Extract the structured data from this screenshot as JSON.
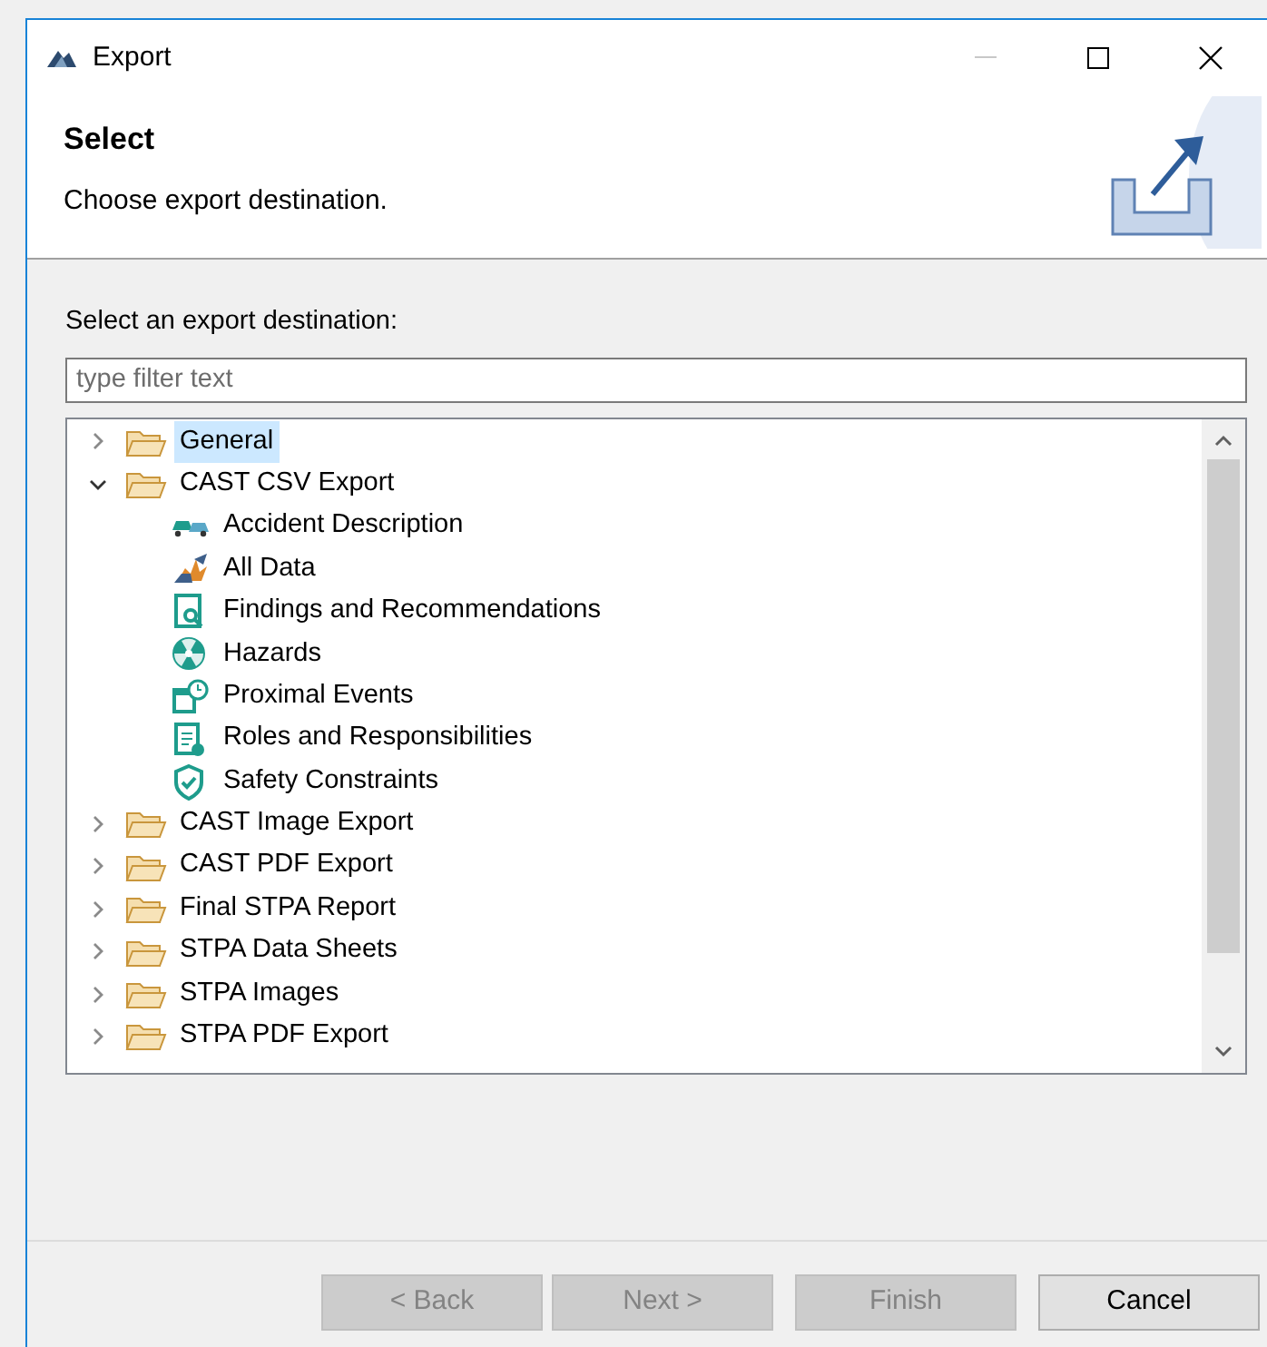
{
  "window": {
    "title": "Export"
  },
  "header": {
    "title": "Select",
    "description": "Choose export destination."
  },
  "filter": {
    "label": "Select an export destination:",
    "placeholder": "type filter text"
  },
  "tree": [
    {
      "label": "General",
      "expanded": false,
      "selected": true
    },
    {
      "label": "CAST CSV Export",
      "expanded": true,
      "selected": false,
      "children": [
        {
          "label": "Accident Description",
          "kind": "cars",
          "selected": false
        },
        {
          "label": "All Data",
          "kind": "collision",
          "selected": false
        },
        {
          "label": "Findings and Recommendations",
          "kind": "search-doc",
          "selected": false
        },
        {
          "label": "Hazards",
          "kind": "hazard",
          "selected": false
        },
        {
          "label": "Proximal Events",
          "kind": "calendar",
          "selected": false
        },
        {
          "label": "Roles and Responsibilities",
          "kind": "clipboard",
          "selected": false
        },
        {
          "label": "Safety Constraints",
          "kind": "shield",
          "selected": false
        }
      ]
    },
    {
      "label": "CAST Image Export",
      "expanded": false,
      "selected": false
    },
    {
      "label": "CAST PDF Export",
      "expanded": false,
      "selected": false
    },
    {
      "label": "Final STPA Report",
      "expanded": false,
      "selected": false
    },
    {
      "label": "STPA Data Sheets",
      "expanded": false,
      "selected": false
    },
    {
      "label": "STPA Images",
      "expanded": false,
      "selected": false
    },
    {
      "label": "STPA PDF Export",
      "expanded": false,
      "selected": false
    }
  ],
  "buttons": [
    {
      "label": "< Back",
      "disabled": true
    },
    {
      "label": "Next >",
      "disabled": true
    },
    {
      "label": "Finish",
      "disabled": true
    },
    {
      "label": "Cancel",
      "disabled": false
    }
  ]
}
